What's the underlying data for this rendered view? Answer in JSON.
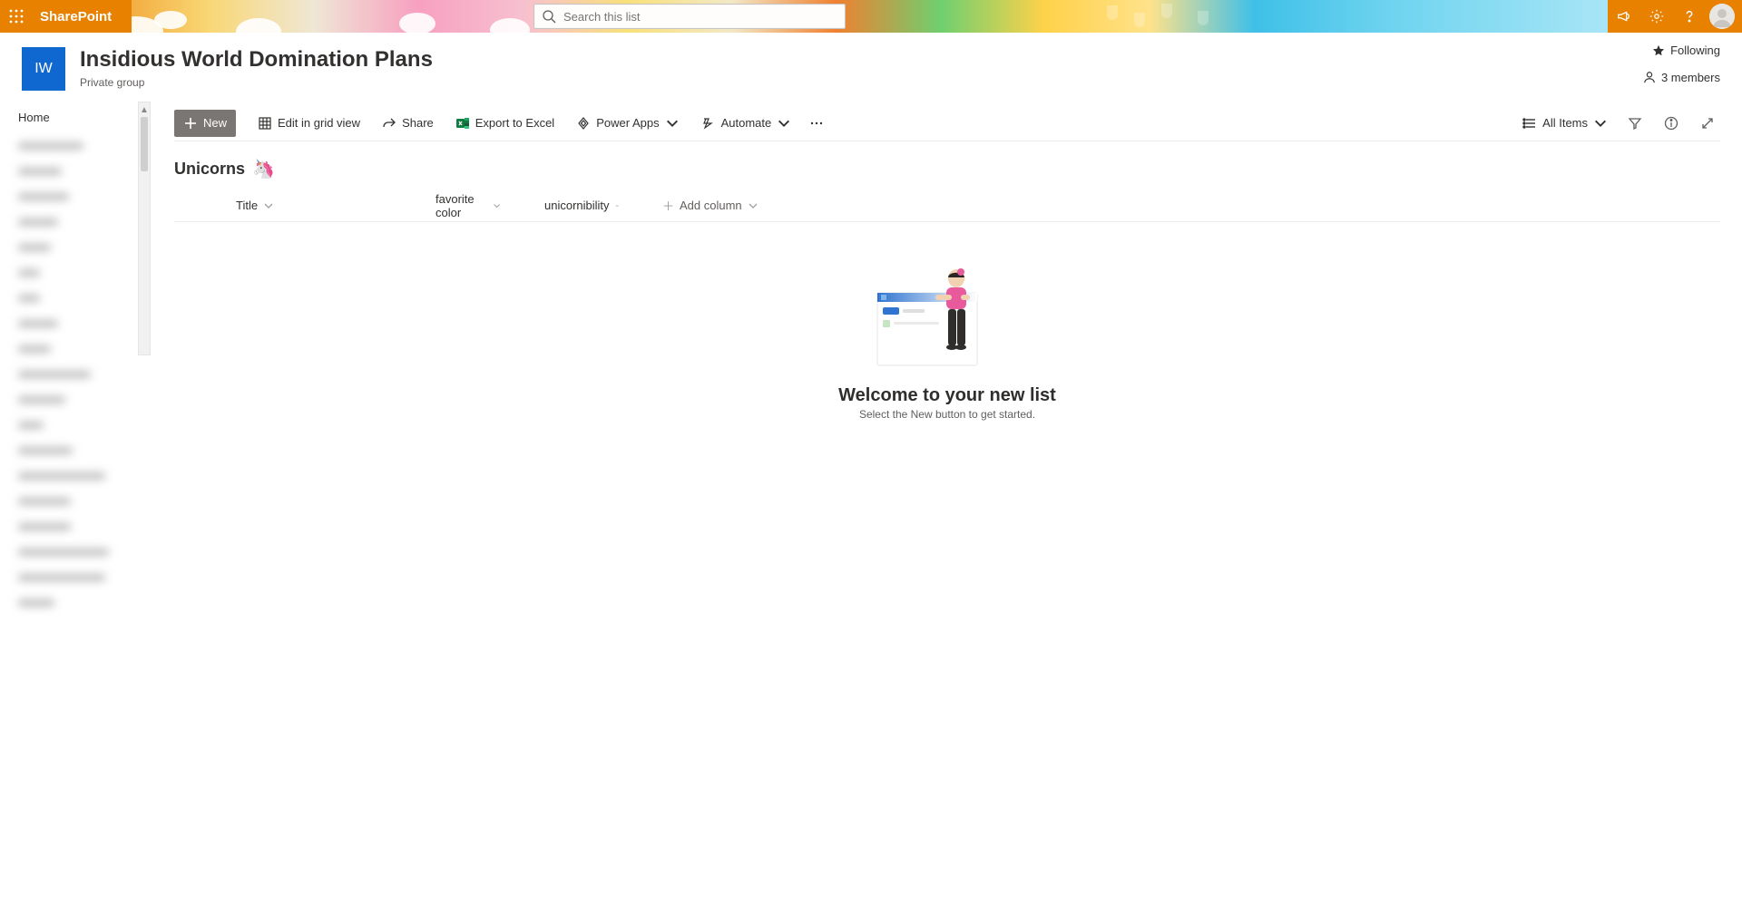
{
  "suite": {
    "app_name": "SharePoint",
    "search_placeholder": "Search this list"
  },
  "site": {
    "logo_initials": "IW",
    "title": "Insidious World Domination Plans",
    "subtitle": "Private group",
    "following_label": "Following",
    "members_label": "3 members"
  },
  "nav": {
    "home": "Home"
  },
  "commands": {
    "new": "New",
    "edit_grid": "Edit in grid view",
    "share": "Share",
    "export_excel": "Export to Excel",
    "power_apps": "Power Apps",
    "automate": "Automate",
    "view_name": "All Items"
  },
  "list": {
    "title": "Unicorns",
    "emoji": "🦄",
    "columns": {
      "title": "Title",
      "favorite_color": "favorite color",
      "unicornibility": "unicornibility",
      "add_column": "Add column"
    }
  },
  "empty": {
    "title": "Welcome to your new list",
    "subtitle": "Select the New button to get started."
  }
}
